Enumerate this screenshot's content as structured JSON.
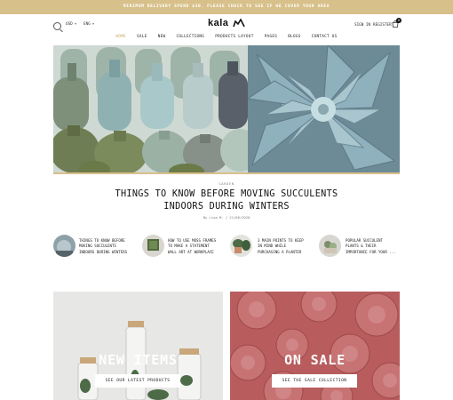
{
  "announcement": "MINIMUM DELIVERY SPEND $30. PLEASE CHECK TO SEE IF WE COVER YOUR AREA",
  "header": {
    "currency": "USD",
    "language": "ENG",
    "logo_text": "kala",
    "sign_in": "SIGN IN",
    "register": "REGISTER",
    "cart_count": "0"
  },
  "nav": {
    "items": [
      "HOME",
      "SALE",
      "NEW",
      "COLLECTIONS",
      "PRODUCTS LAYOUT",
      "PAGES",
      "BLOGS",
      "CONTACT US"
    ],
    "active": "HOME"
  },
  "featured": {
    "category": "GARDEN",
    "title_line1": "THINGS TO KNOW BEFORE MOVING SUCCULENTS",
    "title_line2": "INDOORS DURING WINTERS",
    "meta": "By Lisa M. / 21/06/2020"
  },
  "mini_posts": [
    {
      "l1": "THINGS TO KNOW BEFORE",
      "l2": "MOVING SUCCULENTS",
      "l3": "INDOORS DURING WINTERS"
    },
    {
      "l1": "HOW TO USE MOSS FRAMES",
      "l2": "TO MAKE A STATEMENT",
      "l3": "WALL ART AT WORKPLACE"
    },
    {
      "l1": "3 MAIN POINTS TO KEEP",
      "l2": "IN MIND WHILE",
      "l3": "PURCHASING A PLANTER"
    },
    {
      "l1": "POPULAR SUCCULENT",
      "l2": "PLANTS & THEIR",
      "l3": "IMPORTANCE FOR YOUR ..."
    }
  ],
  "promos": {
    "left_title": "NEW ITEMS",
    "left_button": "SEE OUR LATEST PRODUCTS",
    "right_title": "ON SALE",
    "right_button": "SEE THE SALE COLLECTION"
  },
  "colors": {
    "accent": "#d8c08a",
    "nav_active": "#c9a46b",
    "sale_bg": "#b85c5e"
  }
}
